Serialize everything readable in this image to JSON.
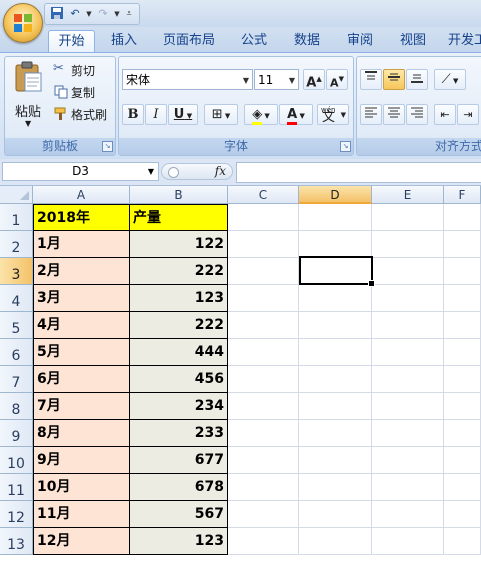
{
  "quick_access": {
    "save_icon": "save-icon",
    "undo_icon": "undo-icon",
    "redo_icon": "redo-icon"
  },
  "tabs": [
    "开始",
    "插入",
    "页面布局",
    "公式",
    "数据",
    "审阅",
    "视图",
    "开发工"
  ],
  "clipboard": {
    "paste_label": "粘贴",
    "cut_label": "剪切",
    "copy_label": "复制",
    "format_painter_label": "格式刷",
    "group_label": "剪贴板"
  },
  "font": {
    "font_name": "宋体",
    "font_size": "11",
    "grow_label": "A",
    "shrink_label": "A",
    "bold": "B",
    "italic": "I",
    "underline": "U",
    "font_color_label": "A",
    "wen_label": "wén",
    "wen_char": "文",
    "group_label": "字体"
  },
  "alignment": {
    "group_label": "对齐方式"
  },
  "formula_bar": {
    "name_box": "D3",
    "fx_label": "fx",
    "formula": ""
  },
  "columns": [
    "A",
    "B",
    "C",
    "D",
    "E",
    "F"
  ],
  "rows": [
    "1",
    "2",
    "3",
    "4",
    "5",
    "6",
    "7",
    "8",
    "9",
    "10",
    "11",
    "12",
    "13"
  ],
  "selected": {
    "cell": "D3",
    "column": "D",
    "row": "3"
  },
  "table": {
    "header": [
      "2018年",
      "产量"
    ],
    "rows": [
      [
        "1月",
        "122"
      ],
      [
        "2月",
        "222"
      ],
      [
        "3月",
        "123"
      ],
      [
        "4月",
        "222"
      ],
      [
        "5月",
        "444"
      ],
      [
        "6月",
        "456"
      ],
      [
        "7月",
        "234"
      ],
      [
        "8月",
        "233"
      ],
      [
        "9月",
        "677"
      ],
      [
        "10月",
        "678"
      ],
      [
        "11月",
        "567"
      ],
      [
        "12月",
        "123"
      ]
    ]
  },
  "colors": {
    "header_fill": "#ffff00",
    "month_fill": "#fde4d4",
    "value_fill": "#ecece2",
    "selection_accent": "#f4c26a"
  }
}
